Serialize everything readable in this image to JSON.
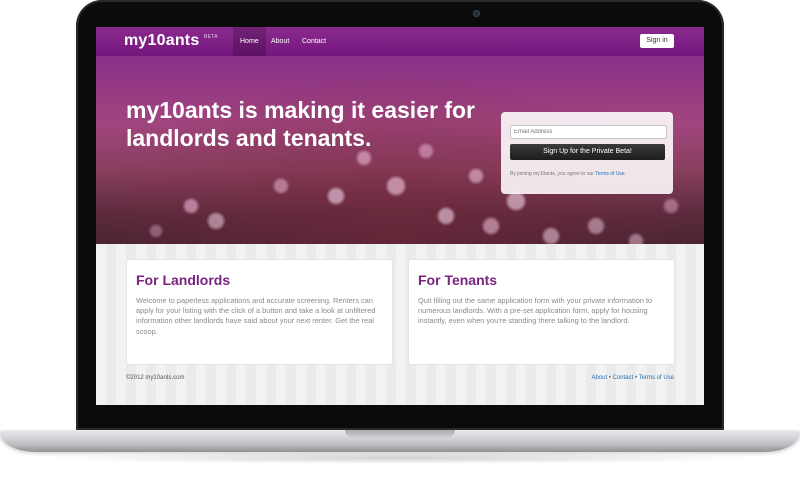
{
  "navbar": {
    "logo": "my10ants",
    "beta": "BETA",
    "items": [
      {
        "label": "Home",
        "active": true
      },
      {
        "label": "About",
        "active": false
      },
      {
        "label": "Contact",
        "active": false
      }
    ],
    "signin_label": "Sign in"
  },
  "hero": {
    "title": "my10ants is making it easier for landlords and tenants.",
    "email_placeholder": "Email Address",
    "signup_label": "Sign Up for the Private Beta!",
    "terms_prefix": "By joining my10ants, you agree to our",
    "terms_link": "Terms of Use",
    "terms_suffix": "."
  },
  "cards": [
    {
      "title": "For Landlords",
      "body": "Welcome to paperless applications and accurate screening. Renters can apply for your listing with the click of a button and take a look at unfiltered information other landlords have said about your next renter. Get the real scoop."
    },
    {
      "title": "For Tenants",
      "body": "Quit filling out the same application form with your private information to numerous landlords. With a pre-set application form, apply for housing instantly, even when you're standing there talking to the landlord."
    }
  ],
  "footer": {
    "copyright": "©2012 my10ants.com",
    "links": [
      "About",
      "Contact",
      "Terms of Use"
    ],
    "separator": "•"
  },
  "colors": {
    "brand_purple": "#7a237f",
    "link_blue": "#2a6db3"
  }
}
